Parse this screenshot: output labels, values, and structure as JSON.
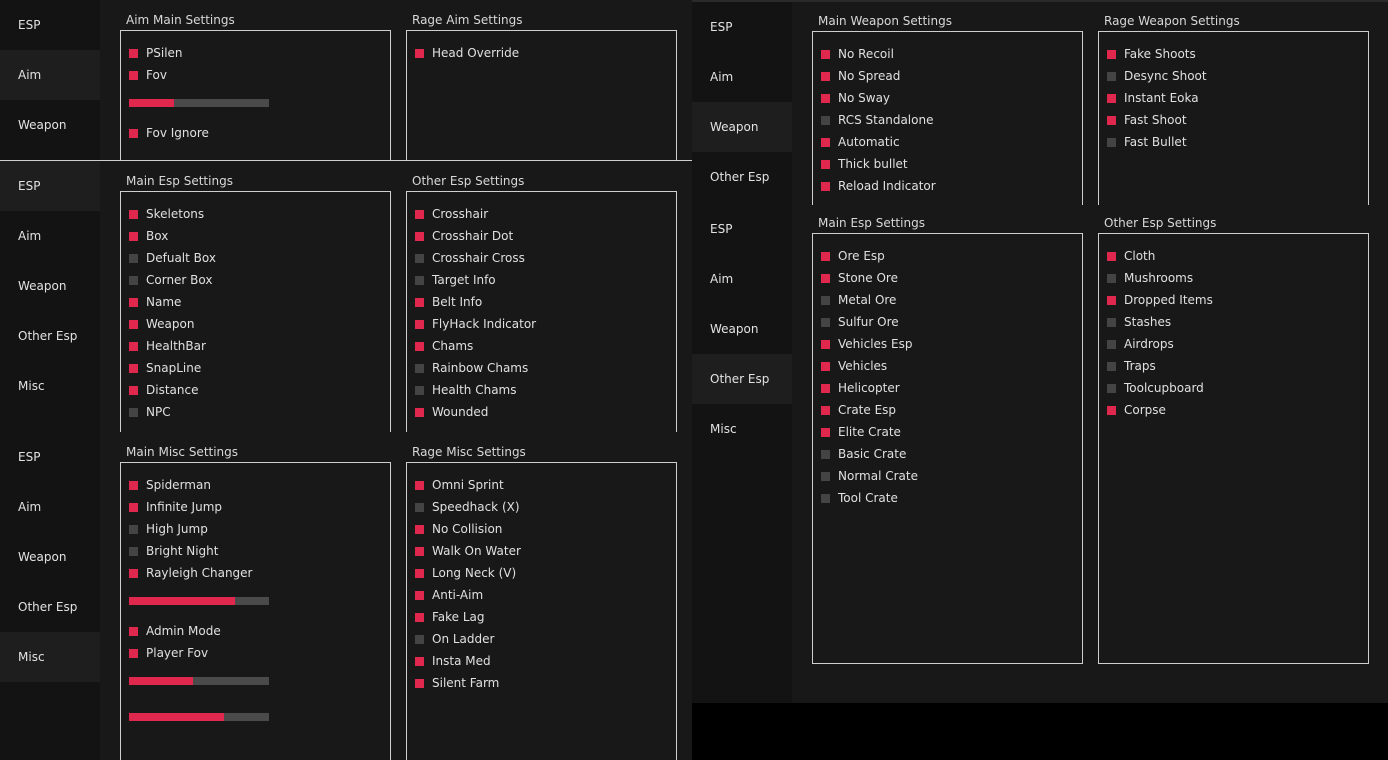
{
  "colors": {
    "accent": "#e0284f",
    "off": "#444444",
    "bg": "#181818",
    "sidebar": "#131313",
    "border": "#cfcfcf"
  },
  "left": {
    "aim_tab": {
      "sidebar": [
        "ESP",
        "Aim",
        "Weapon"
      ],
      "main_title": "Aim Main Settings",
      "main": [
        {
          "type": "check",
          "label": "PSilen",
          "on": true
        },
        {
          "type": "check",
          "label": "Fov",
          "on": true
        },
        {
          "type": "slider",
          "value": 0.32
        },
        {
          "type": "check",
          "label": "Fov Ignore",
          "on": true
        }
      ],
      "rage_title": "Rage Aim Settings",
      "rage": [
        {
          "type": "check",
          "label": "Head Override",
          "on": true
        }
      ]
    },
    "esp_tab": {
      "sidebar": [
        "ESP",
        "Aim",
        "Weapon",
        "Other Esp",
        "Misc"
      ],
      "main_title": "Main Esp Settings",
      "main": [
        {
          "type": "check",
          "label": "Skeletons",
          "on": true
        },
        {
          "type": "check",
          "label": "Box",
          "on": true
        },
        {
          "type": "check",
          "label": "Defualt Box",
          "on": false
        },
        {
          "type": "check",
          "label": "Corner Box",
          "on": false
        },
        {
          "type": "check",
          "label": "Name",
          "on": true
        },
        {
          "type": "check",
          "label": "Weapon",
          "on": true
        },
        {
          "type": "check",
          "label": "HealthBar",
          "on": true
        },
        {
          "type": "check",
          "label": "SnapLine",
          "on": true
        },
        {
          "type": "check",
          "label": "Distance",
          "on": true
        },
        {
          "type": "check",
          "label": "NPC",
          "on": false
        }
      ],
      "other_title": "Other Esp Settings",
      "other": [
        {
          "type": "check",
          "label": "Crosshair",
          "on": true
        },
        {
          "type": "check",
          "label": "Crosshair Dot",
          "on": true
        },
        {
          "type": "check",
          "label": "Crosshair Cross",
          "on": false
        },
        {
          "type": "check",
          "label": "Target Info",
          "on": false
        },
        {
          "type": "check",
          "label": "Belt Info",
          "on": true
        },
        {
          "type": "check",
          "label": "FlyHack Indicator",
          "on": true
        },
        {
          "type": "check",
          "label": "Chams",
          "on": true
        },
        {
          "type": "check",
          "label": "Rainbow Chams",
          "on": false
        },
        {
          "type": "check",
          "label": "Health Chams",
          "on": false
        },
        {
          "type": "check",
          "label": "Wounded",
          "on": true
        }
      ]
    },
    "misc_tab": {
      "sidebar": [
        "ESP",
        "Aim",
        "Weapon",
        "Other Esp",
        "Misc"
      ],
      "main_title": "Main Misc Settings",
      "main": [
        {
          "type": "check",
          "label": "Spiderman",
          "on": true
        },
        {
          "type": "check",
          "label": "Infinite Jump",
          "on": true
        },
        {
          "type": "check",
          "label": "High Jump",
          "on": false
        },
        {
          "type": "check",
          "label": "Bright Night",
          "on": false
        },
        {
          "type": "check",
          "label": "Rayleigh Changer",
          "on": true
        },
        {
          "type": "slider",
          "value": 0.76
        },
        {
          "type": "check",
          "label": "Admin Mode",
          "on": true
        },
        {
          "type": "check",
          "label": "Player Fov",
          "on": true
        },
        {
          "type": "slider",
          "value": 0.46
        },
        {
          "type": "slider",
          "value": 0.68
        }
      ],
      "rage_title": "Rage Misc Settings",
      "rage": [
        {
          "type": "check",
          "label": "Omni Sprint",
          "on": true
        },
        {
          "type": "check",
          "label": "Speedhack (X)",
          "on": false
        },
        {
          "type": "check",
          "label": "No Collision",
          "on": true
        },
        {
          "type": "check",
          "label": "Walk On Water",
          "on": true
        },
        {
          "type": "check",
          "label": "Long Neck (V)",
          "on": true
        },
        {
          "type": "check",
          "label": "Anti-Aim",
          "on": true
        },
        {
          "type": "check",
          "label": "Fake Lag",
          "on": true
        },
        {
          "type": "check",
          "label": "On Ladder",
          "on": false
        },
        {
          "type": "check",
          "label": "Insta Med",
          "on": true
        },
        {
          "type": "check",
          "label": "Silent Farm",
          "on": true
        }
      ]
    }
  },
  "right": {
    "weapon_tab": {
      "sidebar": [
        "ESP",
        "Aim",
        "Weapon",
        "Other Esp"
      ],
      "main_title": "Main Weapon Settings",
      "main": [
        {
          "type": "check",
          "label": "No Recoil",
          "on": true
        },
        {
          "type": "check",
          "label": "No Spread",
          "on": true
        },
        {
          "type": "check",
          "label": "No Sway",
          "on": true
        },
        {
          "type": "check",
          "label": "RCS Standalone",
          "on": false
        },
        {
          "type": "check",
          "label": "Automatic",
          "on": true
        },
        {
          "type": "check",
          "label": "Thick bullet",
          "on": true
        },
        {
          "type": "check",
          "label": "Reload Indicator",
          "on": true
        }
      ],
      "rage_title": "Rage Weapon Settings",
      "rage": [
        {
          "type": "check",
          "label": "Fake Shoots",
          "on": true
        },
        {
          "type": "check",
          "label": "Desync Shoot",
          "on": false
        },
        {
          "type": "check",
          "label": "Instant Eoka",
          "on": true
        },
        {
          "type": "check",
          "label": "Fast Shoot",
          "on": true
        },
        {
          "type": "check",
          "label": "Fast Bullet",
          "on": false
        }
      ]
    },
    "other_esp_tab": {
      "sidebar": [
        "ESP",
        "Aim",
        "Weapon",
        "Other Esp",
        "Misc"
      ],
      "main_title": "Main Esp Settings",
      "main": [
        {
          "type": "check",
          "label": "Ore Esp",
          "on": true
        },
        {
          "type": "check",
          "label": "Stone Ore",
          "on": true
        },
        {
          "type": "check",
          "label": "Metal Ore",
          "on": false
        },
        {
          "type": "check",
          "label": "Sulfur Ore",
          "on": false
        },
        {
          "type": "check",
          "label": "Vehicles Esp",
          "on": true
        },
        {
          "type": "check",
          "label": "Vehicles",
          "on": true
        },
        {
          "type": "check",
          "label": "Helicopter",
          "on": true
        },
        {
          "type": "check",
          "label": "Crate Esp",
          "on": true
        },
        {
          "type": "check",
          "label": "Elite Crate",
          "on": true
        },
        {
          "type": "check",
          "label": "Basic Crate",
          "on": false
        },
        {
          "type": "check",
          "label": "Normal Crate",
          "on": false
        },
        {
          "type": "check",
          "label": "Tool Crate",
          "on": false
        }
      ],
      "other_title": "Other Esp Settings",
      "other": [
        {
          "type": "check",
          "label": "Cloth",
          "on": true
        },
        {
          "type": "check",
          "label": "Mushrooms",
          "on": false
        },
        {
          "type": "check",
          "label": "Dropped Items",
          "on": true
        },
        {
          "type": "check",
          "label": "Stashes",
          "on": false
        },
        {
          "type": "check",
          "label": "Airdrops",
          "on": false
        },
        {
          "type": "check",
          "label": "Traps",
          "on": false
        },
        {
          "type": "check",
          "label": "Toolcupboard",
          "on": false
        },
        {
          "type": "check",
          "label": "Corpse",
          "on": true
        }
      ]
    }
  }
}
